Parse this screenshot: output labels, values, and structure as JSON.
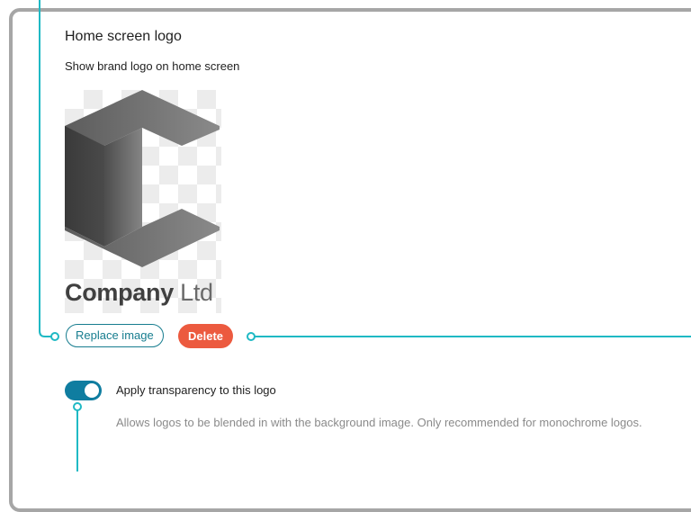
{
  "section": {
    "title": "Home screen logo",
    "subtitle": "Show brand logo on home screen"
  },
  "logo": {
    "name_bold": "Company",
    "name_light": "Ltd",
    "icon": "c-cube-logo-icon"
  },
  "actions": {
    "replace_label": "Replace image",
    "delete_label": "Delete"
  },
  "transparency": {
    "enabled": true,
    "label": "Apply transparency to this logo",
    "help": "Allows logos to be blended in with the background image. Only recommended for monochrome logos."
  },
  "colors": {
    "accent": "#177d8f",
    "callout": "#1fb9c4",
    "toggle_on": "#0f7da0",
    "delete": "#ec5a3f",
    "panel_border": "#a6a6a6"
  }
}
